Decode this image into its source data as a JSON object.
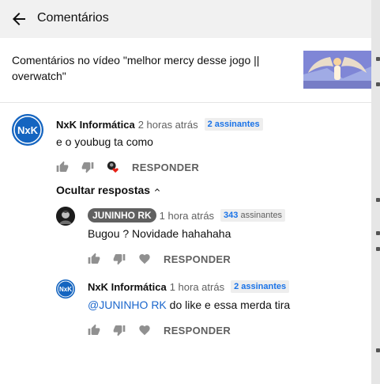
{
  "header": {
    "title": "Comentários"
  },
  "video": {
    "description": "Comentários no vídeo \"melhor mercy desse jogo || overwatch\""
  },
  "comments": [
    {
      "author": "NxK Informática",
      "time": "2 horas atrás",
      "subscribers": "2 assinantes",
      "text": "e o youbug ta como",
      "reply_label": "RESPONDER"
    }
  ],
  "replies_toggle": {
    "label": "Ocultar respostas"
  },
  "replies": [
    {
      "author": "JUNINHO RK",
      "time": "1 hora atrás",
      "subscribers_count": "343",
      "subscribers_word": "assinantes",
      "text": "Bugou ? Novidade hahahaha",
      "reply_label": "RESPONDER"
    },
    {
      "author": "NxK Informática",
      "time": "1 hora atrás",
      "subscribers": "2 assinantes",
      "mention": "@JUNINHO RK",
      "text": " do like e essa merda tira",
      "reply_label": "RESPONDER"
    }
  ],
  "avatars": {
    "nxk": "NxK"
  },
  "colors": {
    "nxk_avatar": "#1565c0",
    "link": "#1a66cc",
    "badge_count": "#1a73e8"
  }
}
